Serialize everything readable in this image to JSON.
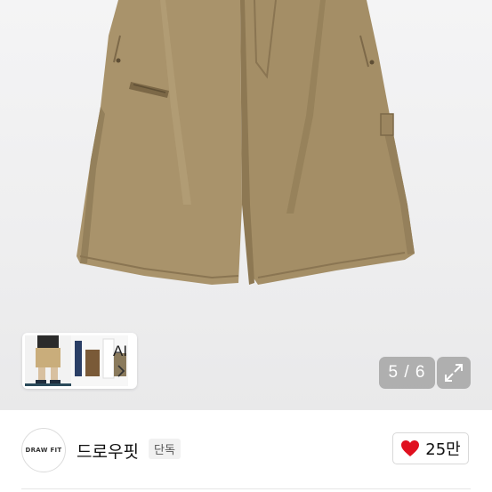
{
  "gallery": {
    "image_icon": "product-photo-shorts",
    "page_counter": "5 / 6",
    "expand_icon": "expand-icon"
  },
  "ai_recommend": {
    "label": "AI",
    "chevron_icon": "chevron-right-icon"
  },
  "seller": {
    "avatar_text": "DRAW FIT",
    "name": "드로우핏",
    "badge": "단독"
  },
  "like": {
    "icon": "heart-icon",
    "count": "25만",
    "color": "#e0101f"
  }
}
